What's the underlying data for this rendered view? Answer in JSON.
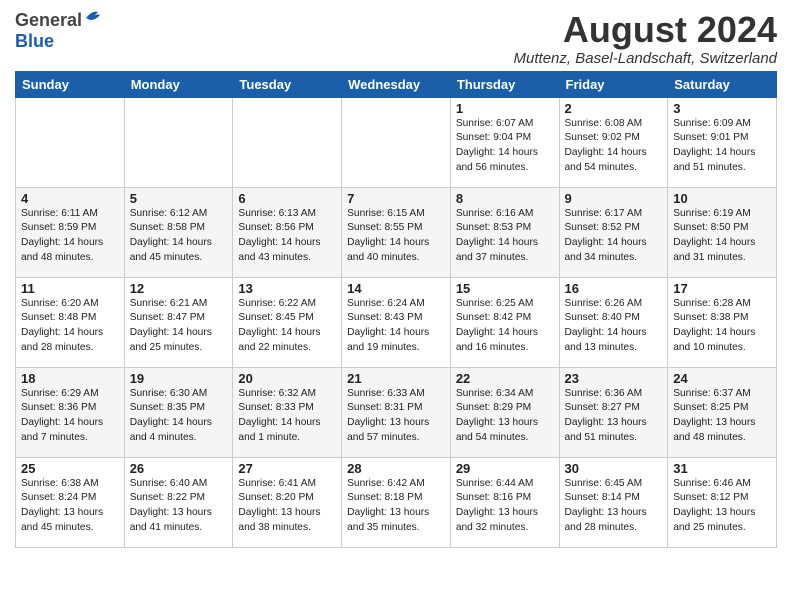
{
  "header": {
    "logo_general": "General",
    "logo_blue": "Blue",
    "title": "August 2024",
    "subtitle": "Muttenz, Basel-Landschaft, Switzerland"
  },
  "days_of_week": [
    "Sunday",
    "Monday",
    "Tuesday",
    "Wednesday",
    "Thursday",
    "Friday",
    "Saturday"
  ],
  "weeks": [
    [
      {
        "day": "",
        "info": ""
      },
      {
        "day": "",
        "info": ""
      },
      {
        "day": "",
        "info": ""
      },
      {
        "day": "",
        "info": ""
      },
      {
        "day": "1",
        "info": "Sunrise: 6:07 AM\nSunset: 9:04 PM\nDaylight: 14 hours\nand 56 minutes."
      },
      {
        "day": "2",
        "info": "Sunrise: 6:08 AM\nSunset: 9:02 PM\nDaylight: 14 hours\nand 54 minutes."
      },
      {
        "day": "3",
        "info": "Sunrise: 6:09 AM\nSunset: 9:01 PM\nDaylight: 14 hours\nand 51 minutes."
      }
    ],
    [
      {
        "day": "4",
        "info": "Sunrise: 6:11 AM\nSunset: 8:59 PM\nDaylight: 14 hours\nand 48 minutes."
      },
      {
        "day": "5",
        "info": "Sunrise: 6:12 AM\nSunset: 8:58 PM\nDaylight: 14 hours\nand 45 minutes."
      },
      {
        "day": "6",
        "info": "Sunrise: 6:13 AM\nSunset: 8:56 PM\nDaylight: 14 hours\nand 43 minutes."
      },
      {
        "day": "7",
        "info": "Sunrise: 6:15 AM\nSunset: 8:55 PM\nDaylight: 14 hours\nand 40 minutes."
      },
      {
        "day": "8",
        "info": "Sunrise: 6:16 AM\nSunset: 8:53 PM\nDaylight: 14 hours\nand 37 minutes."
      },
      {
        "day": "9",
        "info": "Sunrise: 6:17 AM\nSunset: 8:52 PM\nDaylight: 14 hours\nand 34 minutes."
      },
      {
        "day": "10",
        "info": "Sunrise: 6:19 AM\nSunset: 8:50 PM\nDaylight: 14 hours\nand 31 minutes."
      }
    ],
    [
      {
        "day": "11",
        "info": "Sunrise: 6:20 AM\nSunset: 8:48 PM\nDaylight: 14 hours\nand 28 minutes."
      },
      {
        "day": "12",
        "info": "Sunrise: 6:21 AM\nSunset: 8:47 PM\nDaylight: 14 hours\nand 25 minutes."
      },
      {
        "day": "13",
        "info": "Sunrise: 6:22 AM\nSunset: 8:45 PM\nDaylight: 14 hours\nand 22 minutes."
      },
      {
        "day": "14",
        "info": "Sunrise: 6:24 AM\nSunset: 8:43 PM\nDaylight: 14 hours\nand 19 minutes."
      },
      {
        "day": "15",
        "info": "Sunrise: 6:25 AM\nSunset: 8:42 PM\nDaylight: 14 hours\nand 16 minutes."
      },
      {
        "day": "16",
        "info": "Sunrise: 6:26 AM\nSunset: 8:40 PM\nDaylight: 14 hours\nand 13 minutes."
      },
      {
        "day": "17",
        "info": "Sunrise: 6:28 AM\nSunset: 8:38 PM\nDaylight: 14 hours\nand 10 minutes."
      }
    ],
    [
      {
        "day": "18",
        "info": "Sunrise: 6:29 AM\nSunset: 8:36 PM\nDaylight: 14 hours\nand 7 minutes."
      },
      {
        "day": "19",
        "info": "Sunrise: 6:30 AM\nSunset: 8:35 PM\nDaylight: 14 hours\nand 4 minutes."
      },
      {
        "day": "20",
        "info": "Sunrise: 6:32 AM\nSunset: 8:33 PM\nDaylight: 14 hours\nand 1 minute."
      },
      {
        "day": "21",
        "info": "Sunrise: 6:33 AM\nSunset: 8:31 PM\nDaylight: 13 hours\nand 57 minutes."
      },
      {
        "day": "22",
        "info": "Sunrise: 6:34 AM\nSunset: 8:29 PM\nDaylight: 13 hours\nand 54 minutes."
      },
      {
        "day": "23",
        "info": "Sunrise: 6:36 AM\nSunset: 8:27 PM\nDaylight: 13 hours\nand 51 minutes."
      },
      {
        "day": "24",
        "info": "Sunrise: 6:37 AM\nSunset: 8:25 PM\nDaylight: 13 hours\nand 48 minutes."
      }
    ],
    [
      {
        "day": "25",
        "info": "Sunrise: 6:38 AM\nSunset: 8:24 PM\nDaylight: 13 hours\nand 45 minutes."
      },
      {
        "day": "26",
        "info": "Sunrise: 6:40 AM\nSunset: 8:22 PM\nDaylight: 13 hours\nand 41 minutes."
      },
      {
        "day": "27",
        "info": "Sunrise: 6:41 AM\nSunset: 8:20 PM\nDaylight: 13 hours\nand 38 minutes."
      },
      {
        "day": "28",
        "info": "Sunrise: 6:42 AM\nSunset: 8:18 PM\nDaylight: 13 hours\nand 35 minutes."
      },
      {
        "day": "29",
        "info": "Sunrise: 6:44 AM\nSunset: 8:16 PM\nDaylight: 13 hours\nand 32 minutes."
      },
      {
        "day": "30",
        "info": "Sunrise: 6:45 AM\nSunset: 8:14 PM\nDaylight: 13 hours\nand 28 minutes."
      },
      {
        "day": "31",
        "info": "Sunrise: 6:46 AM\nSunset: 8:12 PM\nDaylight: 13 hours\nand 25 minutes."
      }
    ]
  ]
}
